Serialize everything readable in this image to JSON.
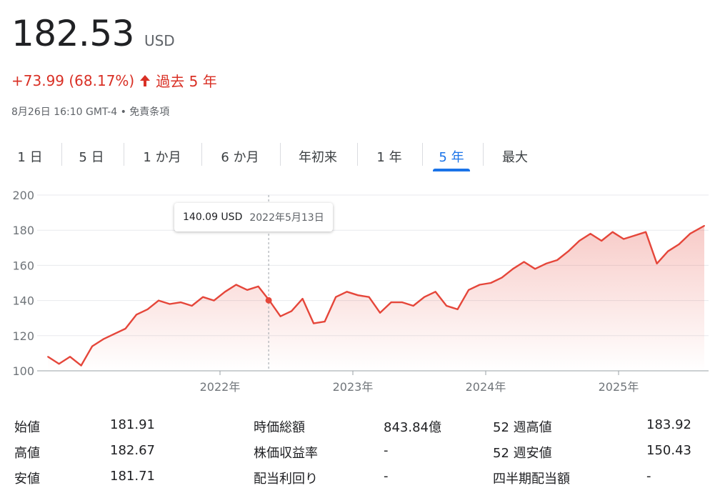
{
  "quote": {
    "price": "182.53",
    "currency": "USD",
    "change": "+73.99 (68.17%)",
    "change_period": "過去 5 年",
    "timestamp": "8月26日 16:10 GMT-4",
    "separator": " • ",
    "disclaimer": "免責条項",
    "negative_color": "#d93025"
  },
  "tabs": [
    {
      "label": "1 日",
      "active": false
    },
    {
      "label": "5 日",
      "active": false
    },
    {
      "label": "1 か月",
      "active": false
    },
    {
      "label": "6 か月",
      "active": false
    },
    {
      "label": "年初来",
      "active": false
    },
    {
      "label": "1 年",
      "active": false
    },
    {
      "label": "5 年",
      "active": true
    },
    {
      "label": "最大",
      "active": false
    }
  ],
  "tooltip": {
    "price": "140.09 USD",
    "date": "2022年5月13日"
  },
  "chart_data": {
    "type": "area",
    "line_color": "#e5463a",
    "ylim": [
      100,
      200
    ],
    "yticks": [
      100,
      120,
      140,
      160,
      180,
      200
    ],
    "xticks": [
      "2022年",
      "2023年",
      "2024年",
      "2025年"
    ],
    "grid": true,
    "hover_value": 140.09,
    "hover_date": "2022-05-13",
    "x": [
      "2020-09",
      "2020-10",
      "2020-11",
      "2020-12",
      "2021-01",
      "2021-02",
      "2021-03",
      "2021-04",
      "2021-05",
      "2021-06",
      "2021-07",
      "2021-08",
      "2021-09",
      "2021-10",
      "2021-11",
      "2021-12",
      "2022-01",
      "2022-02",
      "2022-03",
      "2022-04",
      "2022-05",
      "2022-06",
      "2022-07",
      "2022-08",
      "2022-09",
      "2022-10",
      "2022-11",
      "2022-12",
      "2023-01",
      "2023-02",
      "2023-03",
      "2023-04",
      "2023-05",
      "2023-06",
      "2023-07",
      "2023-08",
      "2023-09",
      "2023-10",
      "2023-11",
      "2023-12",
      "2024-01",
      "2024-02",
      "2024-03",
      "2024-04",
      "2024-05",
      "2024-06",
      "2024-07",
      "2024-08",
      "2024-09",
      "2024-10",
      "2024-11",
      "2024-12",
      "2025-01",
      "2025-02",
      "2025-03",
      "2025-04",
      "2025-05",
      "2025-06",
      "2025-07",
      "2025-08"
    ],
    "values": [
      108,
      104,
      108,
      103,
      114,
      118,
      121,
      124,
      132,
      135,
      140,
      138,
      139,
      137,
      142,
      140,
      145,
      149,
      146,
      148,
      140,
      131,
      134,
      141,
      127,
      128,
      142,
      145,
      143,
      142,
      133,
      139,
      139,
      137,
      142,
      145,
      137,
      135,
      146,
      149,
      150,
      153,
      158,
      162,
      158,
      161,
      163,
      168,
      174,
      178,
      174,
      179,
      175,
      177,
      179,
      161,
      168,
      172,
      178,
      182.53
    ]
  },
  "stats": [
    [
      {
        "label": "始値",
        "value": "181.91"
      },
      {
        "label": "時価総額",
        "value": "843.84億"
      },
      {
        "label": "52 週高値",
        "value": "183.92"
      }
    ],
    [
      {
        "label": "高値",
        "value": "182.67"
      },
      {
        "label": "株価収益率",
        "value": "-"
      },
      {
        "label": "52 週安値",
        "value": "150.43"
      }
    ],
    [
      {
        "label": "安値",
        "value": "181.71"
      },
      {
        "label": "配当利回り",
        "value": "-"
      },
      {
        "label": "四半期配当額",
        "value": "-"
      }
    ]
  ]
}
